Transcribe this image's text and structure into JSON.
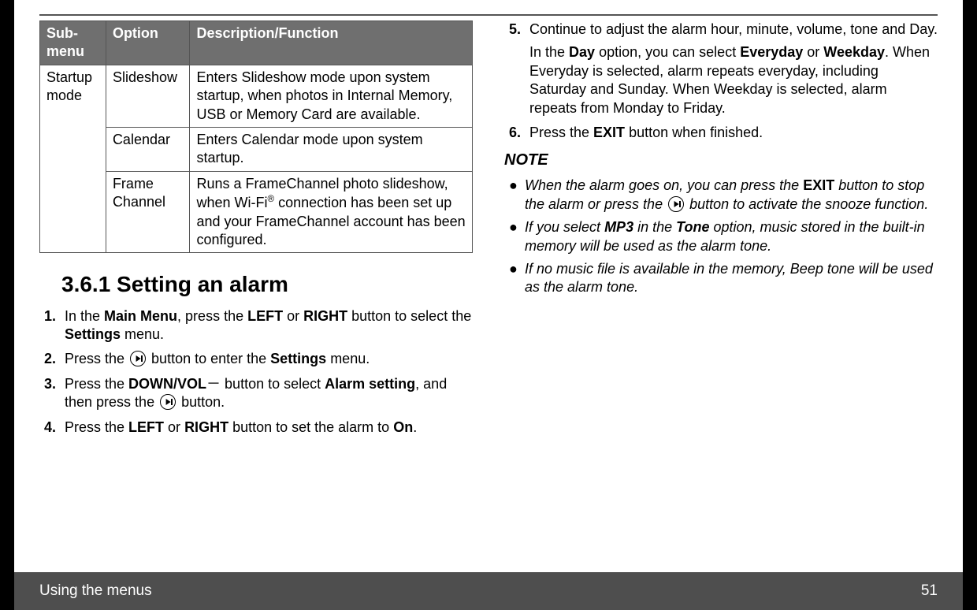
{
  "table": {
    "headers": [
      "Sub-menu",
      "Option",
      "Description/Function"
    ],
    "submenu": "Startup mode",
    "rows": [
      {
        "option": "Slideshow",
        "desc": "Enters Slideshow mode upon system startup, when photos in Internal Memory, USB or Memory Card are available."
      },
      {
        "option": "Calendar",
        "desc": "Enters Calendar mode upon system startup."
      },
      {
        "option": "Frame Channel",
        "desc_pre": "Runs a FrameChannel photo slideshow, when Wi-Fi",
        "desc_post": " connection has been set up and your FrameChannel account has been configured."
      }
    ]
  },
  "section_title": "3.6.1   Setting an alarm",
  "steps": {
    "s1": {
      "num": "1.",
      "t1": "In the ",
      "b1": "Main Menu",
      "t2": ", press the ",
      "b2": "LEFT",
      "t3": " or ",
      "b3": "RIGHT",
      "t4": " button to select the ",
      "b4": "Settings",
      "t5": " menu."
    },
    "s2": {
      "num": "2.",
      "t1": "Press the ",
      "t2": " button to enter the ",
      "b1": "Settings",
      "t3": " menu."
    },
    "s3": {
      "num": "3.",
      "t1": "Press the ",
      "b1": "DOWN/VOL",
      "t2": "－ button to select ",
      "b2": "Alarm setting",
      "t3": ", and then press the ",
      "t4": " button."
    },
    "s4": {
      "num": "4.",
      "t1": "Press the ",
      "b1": "LEFT",
      "t2": " or ",
      "b2": "RIGHT",
      "t3": " button to set the alarm to ",
      "b3": "On",
      "t4": "."
    },
    "s5": {
      "num": "5.",
      "p1": "Continue to adjust the alarm hour, minute, volume, tone and Day.",
      "t1": "In the ",
      "b1": "Day",
      "t2": " option, you can select ",
      "b2": "Everyday",
      "t3": " or ",
      "b3": "Weekday",
      "t4": ". When Everyday is selected, alarm repeats everyday, including Saturday and Sunday. When Weekday is selected, alarm repeats from Monday to Friday."
    },
    "s6": {
      "num": "6.",
      "t1": "Press the ",
      "b1": "EXIT",
      "t2": " button when finished."
    }
  },
  "note_heading": "NOTE",
  "notes": {
    "n1": {
      "t1": "When the alarm goes on, you can press the ",
      "b1": "EXIT",
      "t2": " button to stop the alarm or press the ",
      "t3": " button to activate the snooze function."
    },
    "n2": {
      "t1": "If you select ",
      "b1": "MP3",
      "t2": " in the ",
      "b2": "Tone",
      "t3": " option, music stored in the built-in memory will be used as the alarm tone."
    },
    "n3": {
      "t1": "If no music file is available in the memory, Beep tone will be used as the alarm tone."
    }
  },
  "footer": {
    "title": "Using the menus",
    "page": "51"
  },
  "chart_data": {
    "type": "table",
    "title": "Startup mode options",
    "columns": [
      "Sub-menu",
      "Option",
      "Description/Function"
    ],
    "rows": [
      [
        "Startup mode",
        "Slideshow",
        "Enters Slideshow mode upon system startup, when photos in Internal Memory, USB or Memory Card are available."
      ],
      [
        "Startup mode",
        "Calendar",
        "Enters Calendar mode upon system startup."
      ],
      [
        "Startup mode",
        "Frame Channel",
        "Runs a FrameChannel photo slideshow, when Wi-Fi® connection has been set up and your FrameChannel account has been configured."
      ]
    ]
  }
}
